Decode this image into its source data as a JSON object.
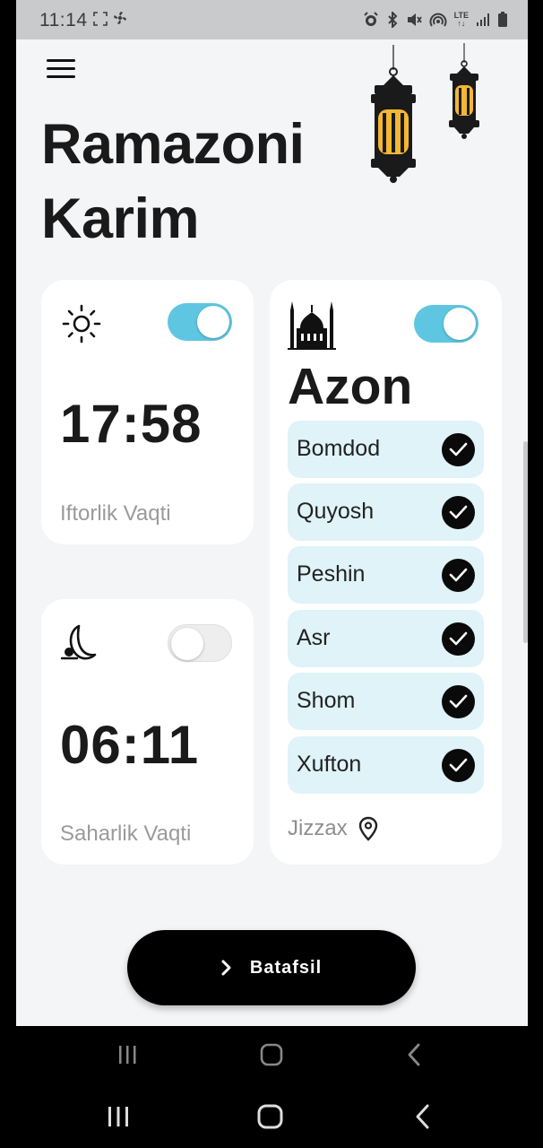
{
  "status_bar": {
    "time": "11:14",
    "left_icons": [
      "screenshot-icon",
      "pinwheel-icon"
    ],
    "right_icons": [
      "alarm-icon",
      "bluetooth-icon",
      "mute-icon",
      "hotspot-icon",
      "lte-icon",
      "signal-icon",
      "battery-icon"
    ],
    "lte_label": "LTE"
  },
  "header": {
    "title_line1": "Ramazoni",
    "title_line2": "Karim"
  },
  "iftor": {
    "time": "17:58",
    "label": "Iftorlik Vaqti",
    "toggle_on": true
  },
  "sahar": {
    "time": "06:11",
    "label": "Saharlik Vaqti",
    "toggle_on": false
  },
  "azon": {
    "title": "Azon",
    "toggle_on": true,
    "prayers": [
      {
        "name": "Bomdod",
        "checked": true
      },
      {
        "name": "Quyosh",
        "checked": true
      },
      {
        "name": "Peshin",
        "checked": true
      },
      {
        "name": "Asr",
        "checked": true
      },
      {
        "name": "Shom",
        "checked": true
      },
      {
        "name": "Xufton",
        "checked": true
      }
    ],
    "city": "Jizzax"
  },
  "more_button": {
    "label": "Batafsil"
  },
  "colors": {
    "accent": "#5fc6e1",
    "prayer_bg": "#dff3f8",
    "background": "#f4f5f7"
  }
}
